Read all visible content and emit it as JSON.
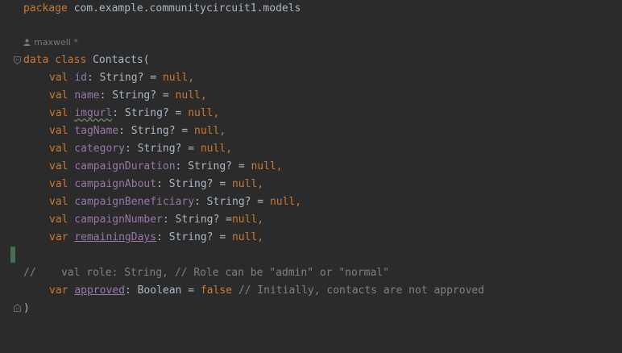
{
  "package_line": {
    "keyword": "package",
    "name": "com.example.communitycircuit1.models"
  },
  "author_hint": {
    "text": "maxwell *",
    "icon": "person-icon"
  },
  "class_decl": {
    "data": "data",
    "class": "class",
    "name": "Contacts("
  },
  "fields": [
    {
      "kw": "val",
      "name": "id",
      "rest": ": String? = ",
      "value": "null",
      "end": ","
    },
    {
      "kw": "val",
      "name": "name",
      "rest": ": String? = ",
      "value": "null",
      "end": ","
    },
    {
      "kw": "val",
      "name": "imgurl",
      "rest": ": String? = ",
      "value": "null",
      "end": ","
    },
    {
      "kw": "val",
      "name": "tagName",
      "rest": ": String? = ",
      "value": "null",
      "end": ","
    },
    {
      "kw": "val",
      "name": "category",
      "rest": ": String? = ",
      "value": "null",
      "end": ","
    },
    {
      "kw": "val",
      "name": "campaignDuration",
      "rest": ": String? = ",
      "value": "null",
      "end": ","
    },
    {
      "kw": "val",
      "name": "campaignAbout",
      "rest": ": String? = ",
      "value": "null",
      "end": ","
    },
    {
      "kw": "val",
      "name": "campaignBeneficiary",
      "rest": ": String? = ",
      "value": "null",
      "end": ","
    },
    {
      "kw": "val",
      "name": "campaignNumber",
      "rest": ": String? =",
      "value": "null",
      "end": ","
    },
    {
      "kw": "var",
      "name": "remainingDays",
      "rest": ": String? = ",
      "value": "null",
      "end": ","
    }
  ],
  "commented_line": "//    val role: String, // Role can be \"admin\" or \"normal\"",
  "approved_line": {
    "kw": "var",
    "name": "approved",
    "rest": ": Boolean = ",
    "value": "false",
    "comment": " // Initially, contacts are not approved"
  },
  "closing": ")",
  "colors": {
    "background": "#2b2b2b",
    "keyword": "#cc7832",
    "property": "#9876aa",
    "text": "#a9b7c6",
    "comment": "#808080"
  }
}
